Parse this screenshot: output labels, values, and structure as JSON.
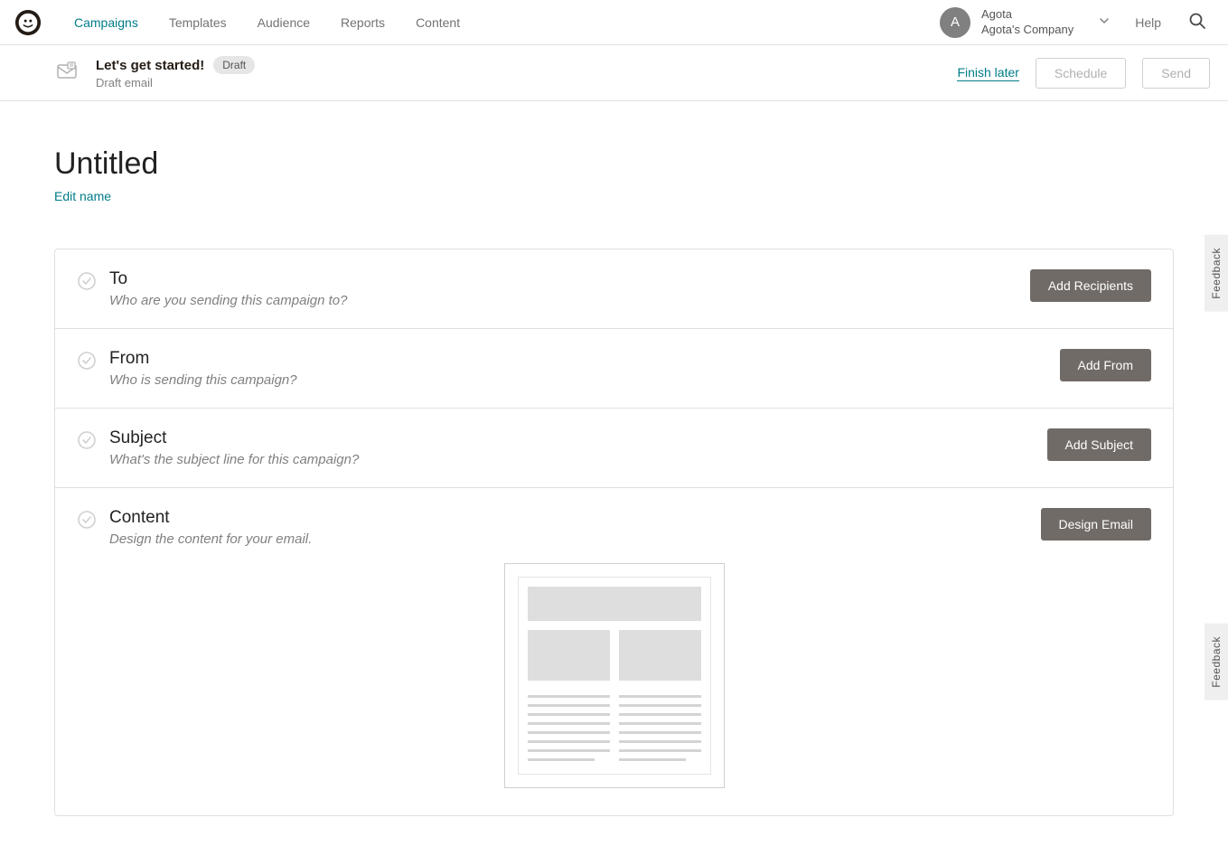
{
  "nav": {
    "items": [
      {
        "label": "Campaigns",
        "active": true
      },
      {
        "label": "Templates",
        "active": false
      },
      {
        "label": "Audience",
        "active": false
      },
      {
        "label": "Reports",
        "active": false
      },
      {
        "label": "Content",
        "active": false
      }
    ],
    "user": {
      "initial": "A",
      "name": "Agota",
      "company": "Agota's Company"
    },
    "help": "Help"
  },
  "subheader": {
    "title": "Let's get started!",
    "status": "Draft",
    "subtitle": "Draft email",
    "finish_later": "Finish later",
    "schedule": "Schedule",
    "send": "Send"
  },
  "page": {
    "title": "Untitled",
    "edit_name": "Edit name"
  },
  "checklist": [
    {
      "title": "To",
      "desc": "Who are you sending this campaign to?",
      "action": "Add Recipients"
    },
    {
      "title": "From",
      "desc": "Who is sending this campaign?",
      "action": "Add From"
    },
    {
      "title": "Subject",
      "desc": "What's the subject line for this campaign?",
      "action": "Add Subject"
    },
    {
      "title": "Content",
      "desc": "Design the content for your email.",
      "action": "Design Email"
    }
  ],
  "feedback": "Feedback"
}
